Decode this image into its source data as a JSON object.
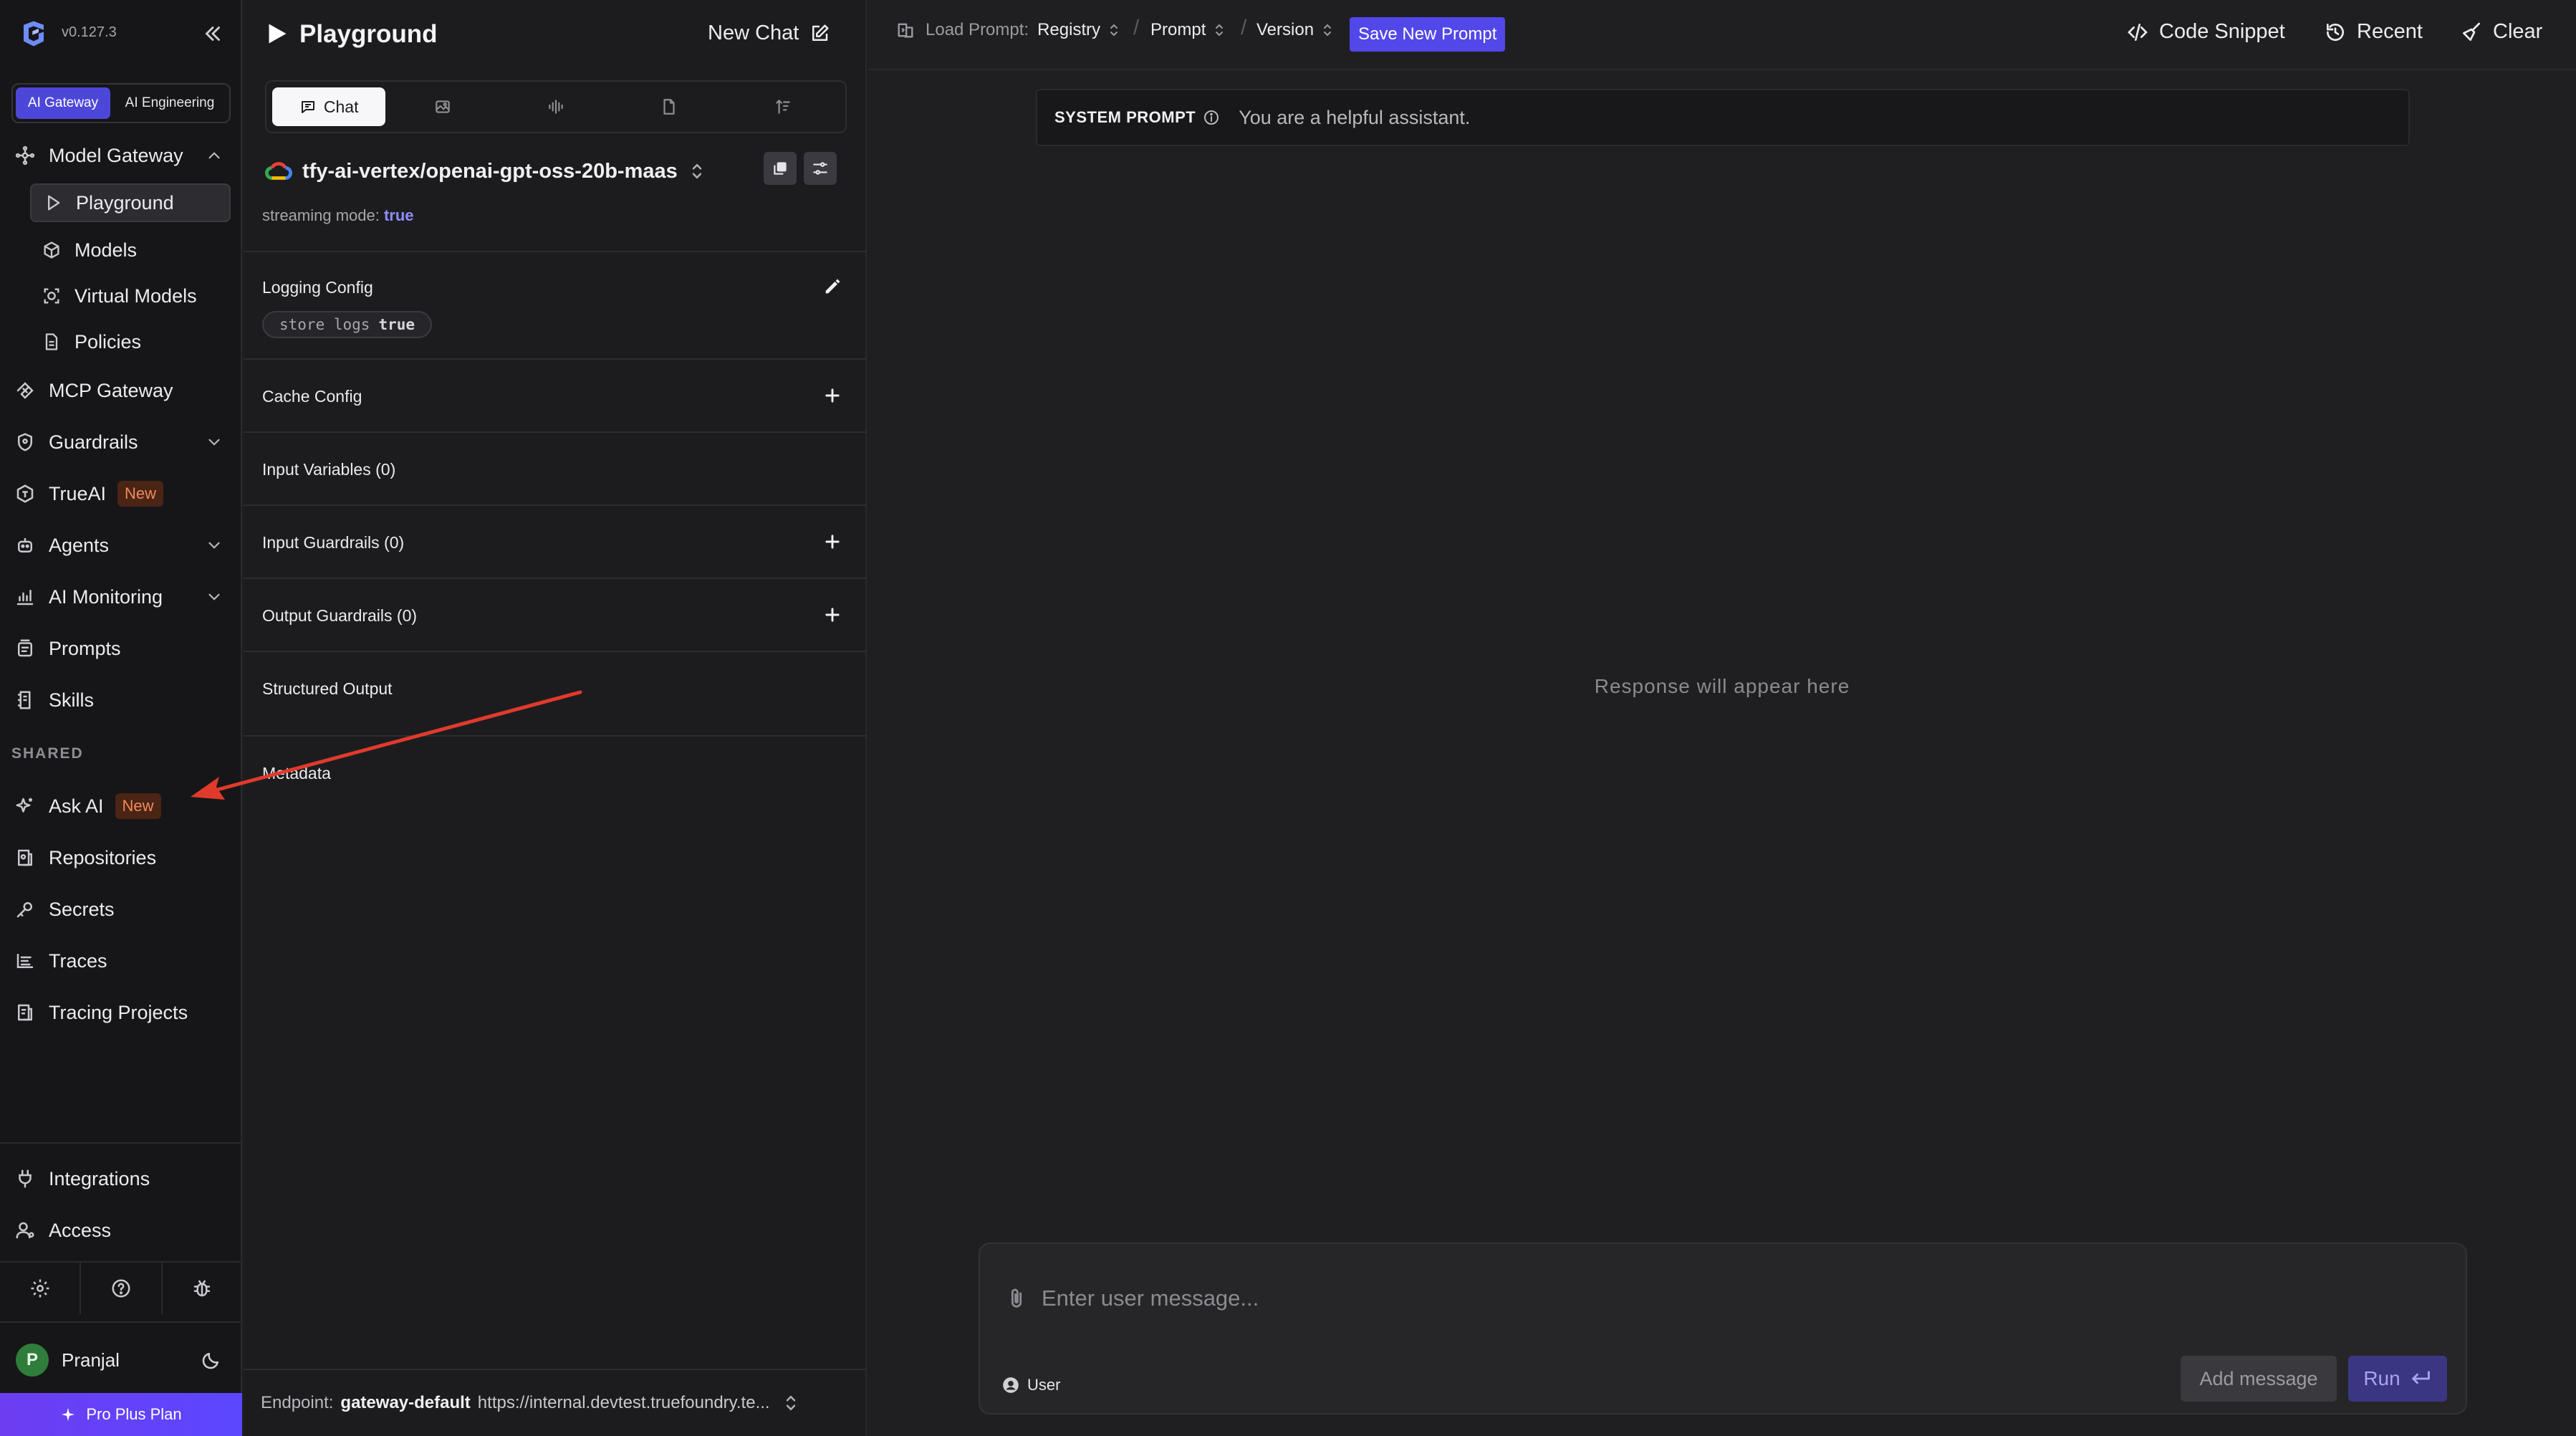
{
  "app": {
    "version": "v0.127.3"
  },
  "sidebar": {
    "switcher": [
      "AI Gateway",
      "AI Engineering"
    ],
    "model_gateway": {
      "label": "Model Gateway",
      "children": [
        "Playground",
        "Models",
        "Virtual Models",
        "Policies"
      ]
    },
    "items": {
      "mcp_gateway": "MCP Gateway",
      "guardrails": "Guardrails",
      "trueai": "TrueAI",
      "agents": "Agents",
      "ai_monitoring": "AI Monitoring",
      "prompts": "Prompts",
      "skills": "Skills"
    },
    "new_badge": "New",
    "shared_label": "SHARED",
    "shared": {
      "ask_ai": "Ask AI",
      "repositories": "Repositories",
      "secrets": "Secrets",
      "traces": "Traces",
      "tracing_projects": "Tracing Projects"
    },
    "bottom": {
      "integrations": "Integrations",
      "access": "Access"
    },
    "user": {
      "initial": "P",
      "name": "Pranjal"
    },
    "plan": "Pro Plus Plan"
  },
  "config": {
    "title": "Playground",
    "new_chat": "New Chat",
    "mode_tab_chat": "Chat",
    "model": "tfy-ai-vertex/openai-gpt-oss-20b-maas",
    "streaming_label": "streaming mode:",
    "streaming_value": "true",
    "logging_config": "Logging Config",
    "store_logs_label": "store logs",
    "store_logs_value": "true",
    "cache_config": "Cache Config",
    "input_variables": "Input Variables (0)",
    "input_guardrails": "Input Guardrails (0)",
    "output_guardrails": "Output Guardrails (0)",
    "structured_output": "Structured Output",
    "metadata": "Metadata",
    "endpoint_label": "Endpoint:",
    "endpoint_name": "gateway-default",
    "endpoint_url": "https://internal.devtest.truefoundry.te..."
  },
  "topbar": {
    "load_prompt": "Load Prompt:",
    "registry": "Registry",
    "prompt": "Prompt",
    "version": "Version",
    "save_new_prompt": "Save New Prompt",
    "code_snippet": "Code Snippet",
    "recent": "Recent",
    "clear": "Clear"
  },
  "chat": {
    "system_prompt_label": "SYSTEM PROMPT",
    "system_prompt": "You are a helpful assistant.",
    "response_placeholder": "Response will appear here",
    "input_placeholder": "Enter user message...",
    "role": "User",
    "add_message": "Add message",
    "run": "Run"
  },
  "colors": {
    "accent": "#5247e8",
    "badge_new": "#f08a5d",
    "annotation_arrow": "#e03a2c"
  }
}
